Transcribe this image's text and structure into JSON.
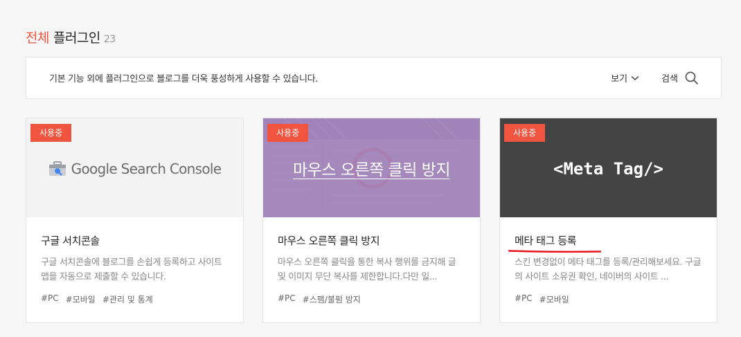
{
  "heading": {
    "accent": "전체",
    "rest": "플러그인",
    "count": "23"
  },
  "infobar": {
    "description": "기본 기능 외에 플러그인으로 블로그를 더욱 풍성하게 사용할 수 있습니다.",
    "view_label": "보기",
    "search_label": "검색"
  },
  "cards": [
    {
      "badge": "사용중",
      "thumb_text": "Google Search Console",
      "title": "구글 서치콘솔",
      "description": "구글 서치콘솔에 블로그를 손쉽게 등록하고 사이트맵을 자동으로 제출할 수 있습니다.",
      "tags": [
        "#PC",
        "#모바일",
        "#관리 및 통계"
      ]
    },
    {
      "badge": "사용중",
      "thumb_text": "마우스 오른쪽 클릭 방지",
      "title": "마우스 오른쪽 클릭 방지",
      "description": "마우스 오른쪽 클릭을 통한 복사 행위를 금지해 글 및 이미지 무단 복사를 제한합니다.다만 일...",
      "tags": [
        "#PC",
        "#스팸/불펌 방지"
      ]
    },
    {
      "badge": "사용중",
      "thumb_text": "<Meta Tag/>",
      "title": "메타 태그 등록",
      "description": "스킨 변경없이 메타 태그를 등록/관리해보세요. 구글의 사이트 소유권 확인, 네이버의 사이트 ...",
      "tags": [
        "#PC",
        "#모바일"
      ]
    }
  ],
  "colors": {
    "accent": "#f1543f",
    "annotation": "#e8101a",
    "meta_bg": "#444444",
    "mouse_overlay": "#a990bd"
  }
}
